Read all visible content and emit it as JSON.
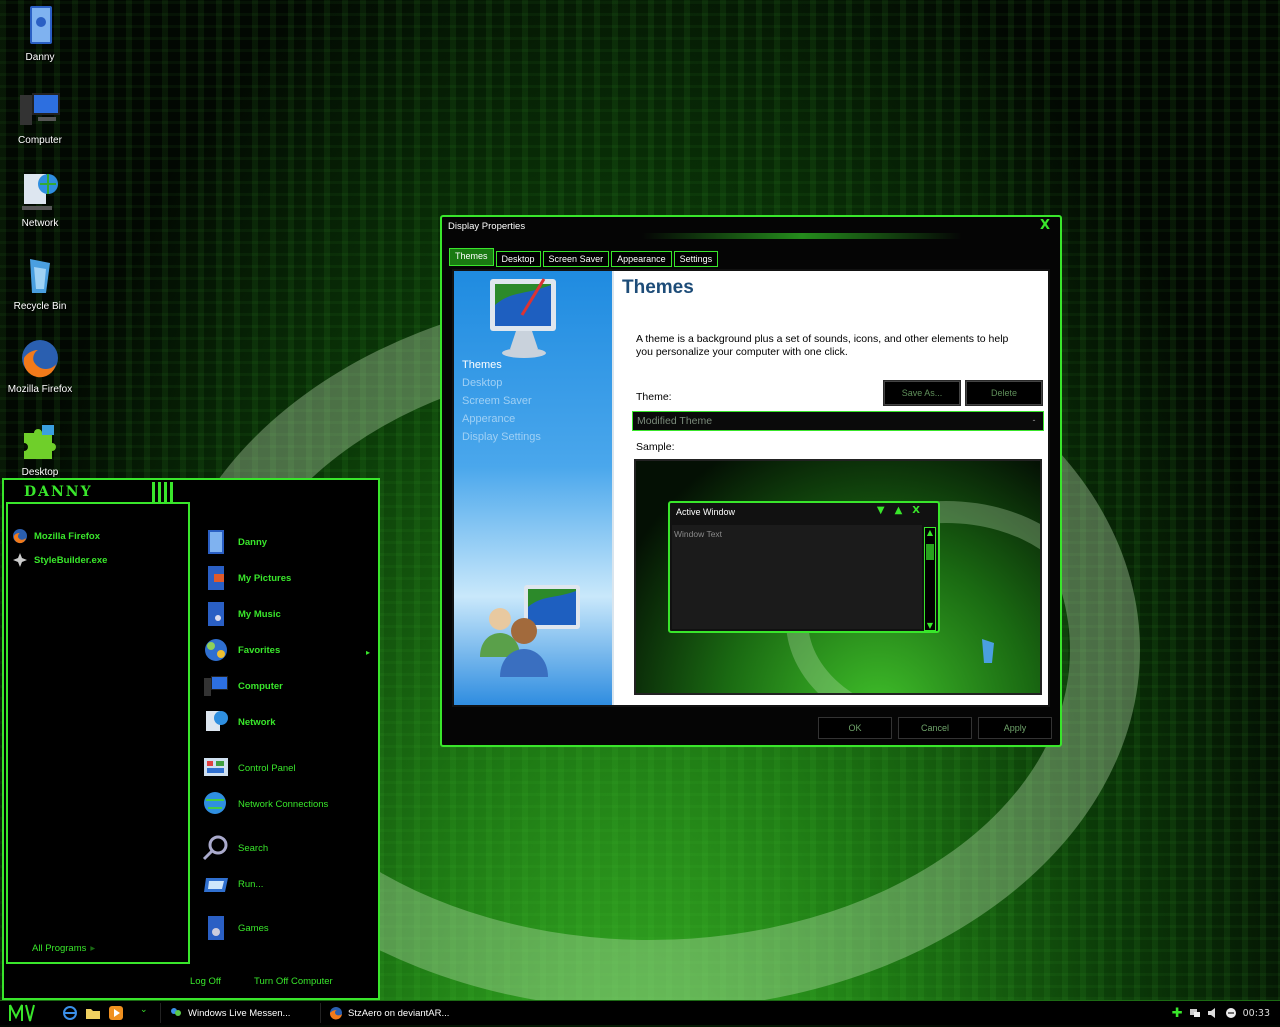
{
  "desktop": {
    "icons": [
      {
        "label": "Danny",
        "icon": "user-folder-icon"
      },
      {
        "label": "Computer",
        "icon": "computer-icon"
      },
      {
        "label": "Network",
        "icon": "network-icon"
      },
      {
        "label": "Recycle Bin",
        "icon": "recycle-bin-icon"
      },
      {
        "label": "Mozilla Firefox",
        "icon": "firefox-icon"
      },
      {
        "label": "Desktop",
        "icon": "puzzle-icon"
      }
    ]
  },
  "start_menu": {
    "user_name": "DANNY",
    "pinned": [
      {
        "label": "Mozilla Firefox",
        "icon": "firefox-icon"
      },
      {
        "label": "StyleBuilder.exe",
        "icon": "stylebuilder-icon"
      }
    ],
    "all_programs": "All Programs",
    "places": [
      {
        "label": "Danny",
        "icon": "user-folder-icon",
        "bold": true
      },
      {
        "label": "My Pictures",
        "icon": "pictures-folder-icon",
        "bold": true
      },
      {
        "label": "My Music",
        "icon": "music-folder-icon",
        "bold": true
      },
      {
        "label": "Favorites",
        "icon": "favorites-icon",
        "bold": true
      },
      {
        "label": "Computer",
        "icon": "computer-icon",
        "bold": true
      },
      {
        "label": "Network",
        "icon": "network-icon",
        "bold": true
      },
      {
        "label": "Control Panel",
        "icon": "control-panel-icon",
        "bold": false
      },
      {
        "label": "Network Connections",
        "icon": "network-connections-icon",
        "bold": false
      },
      {
        "label": "Search",
        "icon": "search-icon",
        "bold": false
      },
      {
        "label": "Run...",
        "icon": "run-icon",
        "bold": false
      },
      {
        "label": "Games",
        "icon": "games-icon",
        "bold": false
      }
    ],
    "log_off": "Log Off",
    "turn_off": "Turn Off Computer"
  },
  "taskbar": {
    "buttons": [
      {
        "label": "Windows Live Messen...",
        "icon": "messenger-icon"
      },
      {
        "label": "StzAero on deviantAR...",
        "icon": "firefox-icon"
      }
    ],
    "clock": "00:33"
  },
  "dialog": {
    "title": "Display Properties",
    "tabs": [
      "Themes",
      "Desktop",
      "Screen Saver",
      "Appearance",
      "Settings"
    ],
    "active_tab": "Themes",
    "side_links": [
      "Themes",
      "Desktop",
      "Screem Saver",
      "Apperance",
      "Display Settings"
    ],
    "heading": "Themes",
    "description": "A theme is a background plus a set of sounds, icons, and other elements to help you personalize your computer with one click.",
    "theme_label": "Theme:",
    "save_as": "Save As...",
    "delete": "Delete",
    "theme_value": "Modified Theme",
    "sample_label": "Sample:",
    "sample_window_title": "Active Window",
    "sample_window_text": "Window Text",
    "ok": "OK",
    "cancel": "Cancel",
    "apply": "Apply",
    "accent_color": "#39e62b"
  }
}
